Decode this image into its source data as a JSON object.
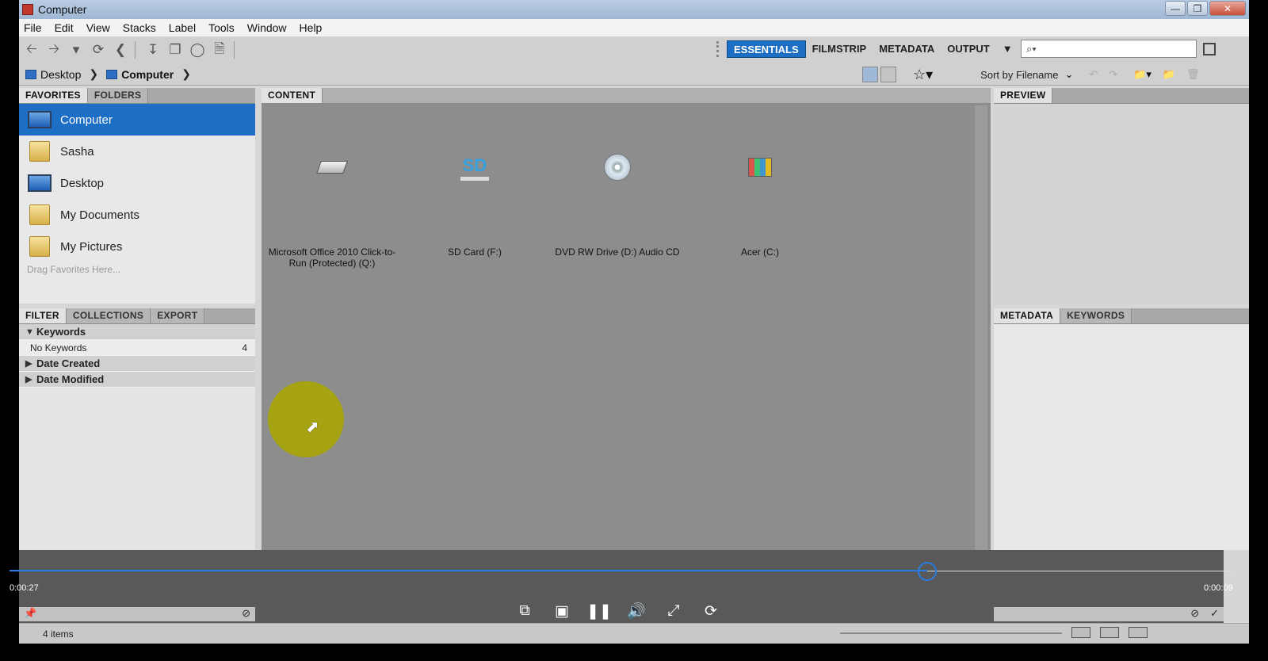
{
  "window": {
    "title": "Computer"
  },
  "menu": [
    "File",
    "Edit",
    "View",
    "Stacks",
    "Label",
    "Tools",
    "Window",
    "Help"
  ],
  "workspaces": {
    "items": [
      "ESSENTIALS",
      "FILMSTRIP",
      "METADATA",
      "OUTPUT"
    ],
    "active": "ESSENTIALS"
  },
  "search": {
    "placeholder": "⌕▾"
  },
  "path": {
    "crumbs": [
      "Desktop",
      "Computer"
    ]
  },
  "sort": {
    "label": "Sort by Filename"
  },
  "favorites": {
    "tabs": [
      "FAVORITES",
      "FOLDERS"
    ],
    "items": [
      "Computer",
      "Sasha",
      "Desktop",
      "My Documents",
      "My Pictures"
    ],
    "selected": "Computer",
    "hint": "Drag Favorites Here..."
  },
  "filter": {
    "tabs": [
      "FILTER",
      "COLLECTIONS",
      "EXPORT"
    ],
    "groups": [
      {
        "label": "Keywords",
        "expanded": true
      },
      {
        "label": "No Keywords",
        "count": "4"
      },
      {
        "label": "Date Created",
        "expanded": false
      },
      {
        "label": "Date Modified",
        "expanded": false
      }
    ]
  },
  "content": {
    "tab": "CONTENT",
    "items": [
      {
        "name": "Microsoft Office 2010 Click-to-Run (Protected) (Q:)",
        "icon": "drive-icon"
      },
      {
        "name": "SD Card (F:)",
        "icon": "sd-card-icon",
        "badge": "SD"
      },
      {
        "name": "DVD RW Drive (D:) Audio CD",
        "icon": "dvd-icon"
      },
      {
        "name": "Acer (C:)",
        "icon": "windows-drive-icon"
      }
    ]
  },
  "preview": {
    "tab": "PREVIEW"
  },
  "metadata": {
    "tabs": [
      "METADATA",
      "KEYWORDS"
    ]
  },
  "status": {
    "items_count": "4 items"
  },
  "video": {
    "elapsed": "0:00:27",
    "remaining": "0:00:09",
    "progress": 0.75
  },
  "colors": {
    "accent": "#1c6fc4",
    "cursor_highlight": "#a5a311",
    "progress": "#2a7be0"
  }
}
